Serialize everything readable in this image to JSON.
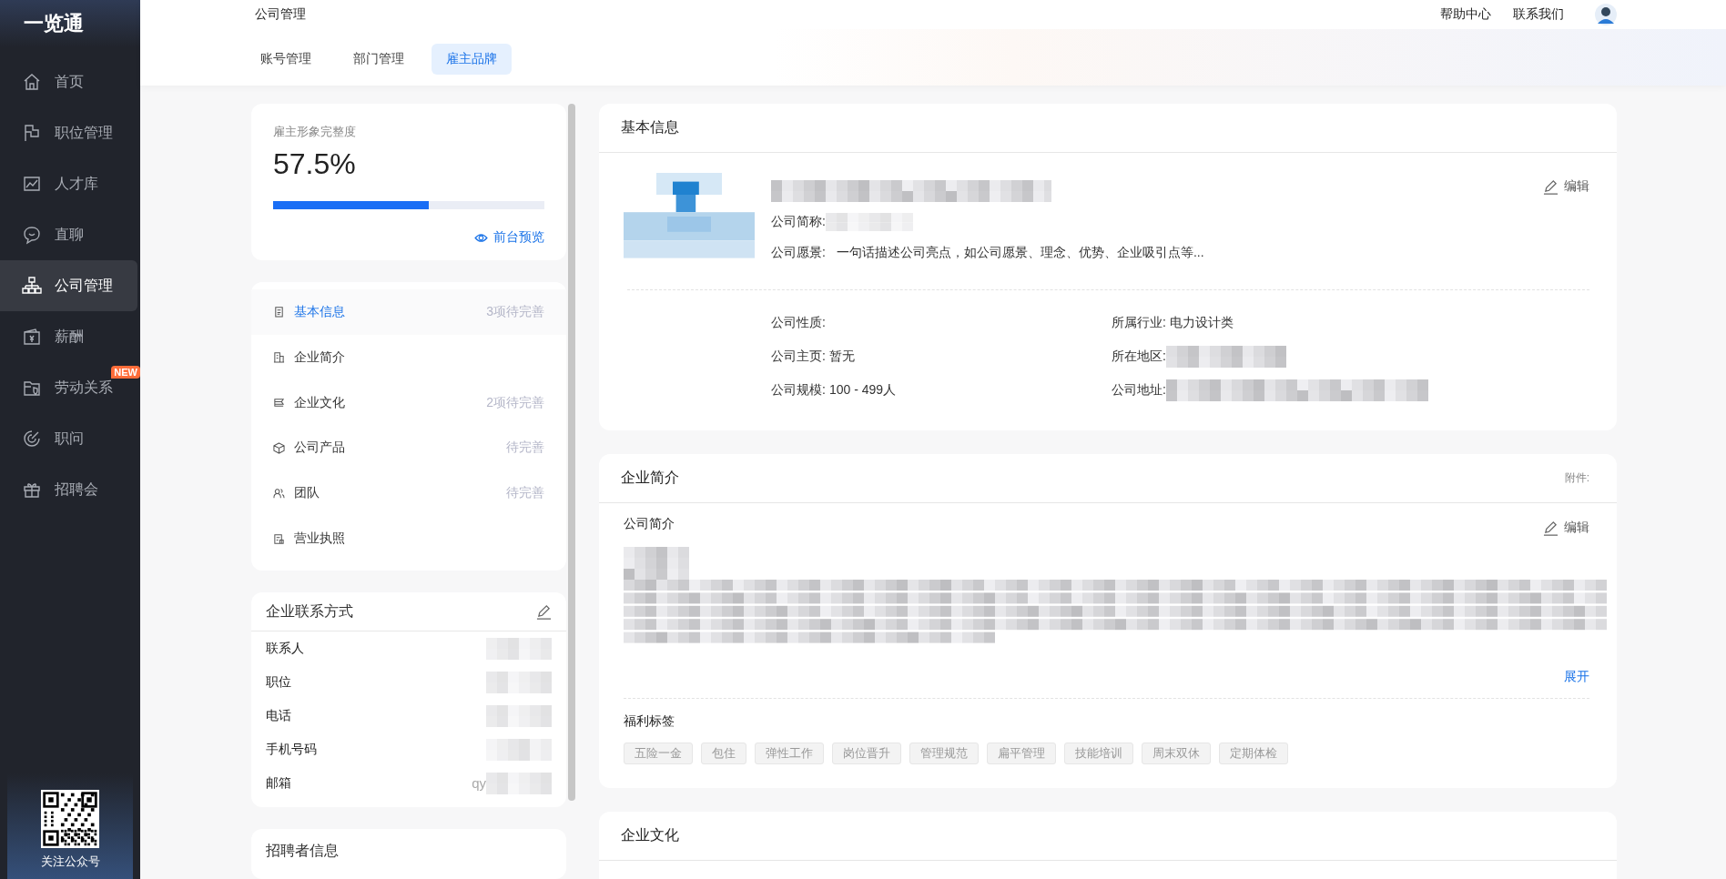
{
  "sidebar": {
    "logo": "一览通",
    "items": [
      {
        "label": "首页",
        "kind": "home",
        "selected": false
      },
      {
        "label": "职位管理",
        "kind": "flag",
        "selected": false
      },
      {
        "label": "人才库",
        "kind": "chart",
        "selected": false
      },
      {
        "label": "直聊",
        "kind": "chat",
        "selected": false
      },
      {
        "label": "公司管理",
        "kind": "org",
        "selected": true
      },
      {
        "label": "薪酬",
        "kind": "wallet",
        "selected": false
      },
      {
        "label": "劳动关系",
        "kind": "folder",
        "selected": false,
        "badge": "NEW"
      },
      {
        "label": "职问",
        "kind": "target",
        "selected": false
      },
      {
        "label": "招聘会",
        "kind": "gift",
        "selected": false
      }
    ],
    "qr_caption": "关注公众号"
  },
  "header": {
    "title": "公司管理",
    "links": [
      "帮助中心",
      "联系我们"
    ]
  },
  "tabs": [
    {
      "label": "账号管理",
      "selected": false
    },
    {
      "label": "部门管理",
      "selected": false
    },
    {
      "label": "雇主品牌",
      "selected": true
    }
  ],
  "completeness": {
    "label": "雇主形象完整度",
    "value": "57.5%",
    "level": 0.575,
    "preview": "前台预览"
  },
  "sections": [
    {
      "label": "基本信息",
      "kind": "clipboard",
      "status": "3项待完善",
      "selected": true
    },
    {
      "label": "企业简介",
      "kind": "building",
      "selected": false
    },
    {
      "label": "企业文化",
      "kind": "layers",
      "status": "2项待完善",
      "selected": false
    },
    {
      "label": "公司产品",
      "kind": "box",
      "status": "待完善",
      "selected": false
    },
    {
      "label": "团队",
      "kind": "people",
      "status": "待完善",
      "selected": false
    },
    {
      "label": "营业执照",
      "kind": "license",
      "selected": false
    }
  ],
  "contact": {
    "title": "企业联系方式",
    "rows": [
      {
        "label": "联系人"
      },
      {
        "label": "职位"
      },
      {
        "label": "电话"
      },
      {
        "label": "手机号码"
      },
      {
        "label": "邮箱",
        "value": "qy"
      }
    ]
  },
  "recruiter": {
    "title": "招聘者信息"
  },
  "basic": {
    "title": "基本信息",
    "edit": "编辑",
    "intro_rows": [
      {
        "label": "公司简称:",
        "blurred": true
      },
      {
        "label": "公司愿景:",
        "value": "一句话描述公司亮点，如公司愿景、理念、优势、企业吸引点等..."
      }
    ],
    "fields": [
      {
        "label": "公司性质:"
      },
      {
        "label": "所属行业:",
        "value": "电力设计类"
      },
      {
        "label": "公司主页:",
        "value": "暂无"
      },
      {
        "label": "所在地区:",
        "blurred": true
      },
      {
        "label": "公司规模:",
        "value": "100 - 499人"
      },
      {
        "label": "公司地址:",
        "blurred": true
      }
    ]
  },
  "profile": {
    "title": "企业简介",
    "attachment": "附件:",
    "subtitle": "公司简介",
    "edit": "编辑",
    "expand": "展开",
    "tags_title": "福利标签",
    "tags": [
      "五险一金",
      "包住",
      "弹性工作",
      "岗位晋升",
      "管理规范",
      "扁平管理",
      "技能培训",
      "周末双休",
      "定期体检"
    ]
  },
  "culture": {
    "title": "企业文化"
  }
}
